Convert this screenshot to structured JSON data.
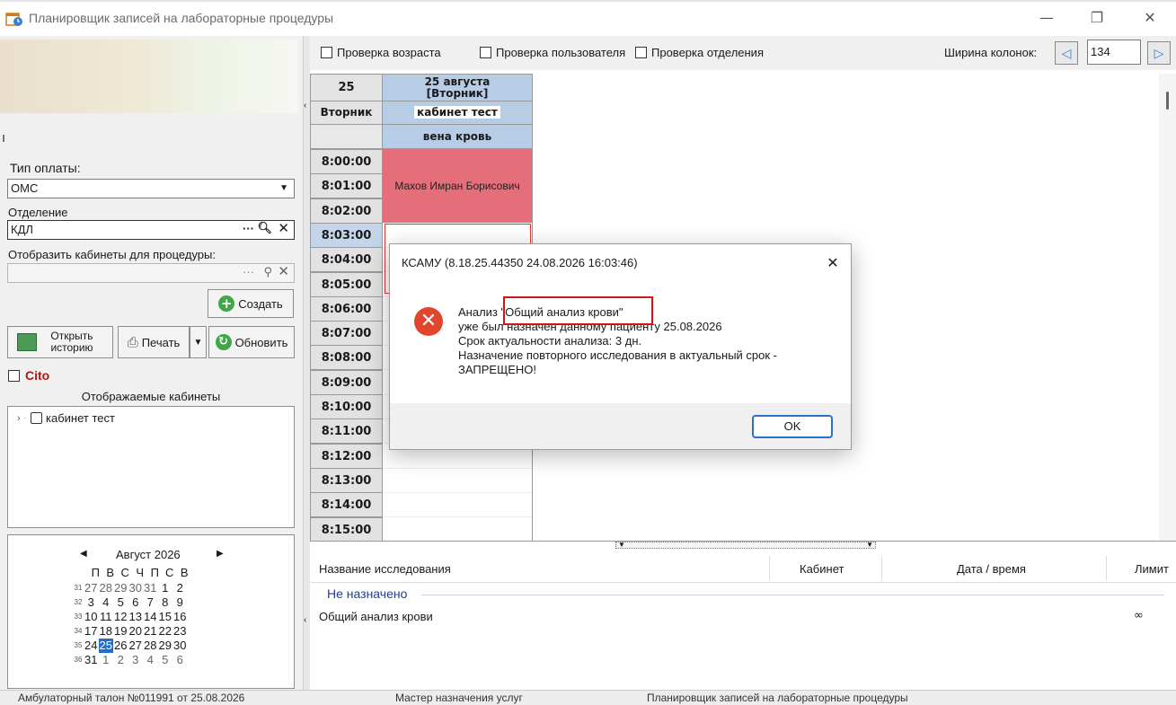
{
  "window": {
    "title": "Планировщик записей на лабораторные процедуры",
    "minimize": "—",
    "maximize": "❐",
    "close": "✕"
  },
  "left": {
    "payment_label": "Тип оплаты:",
    "payment_value": "ОМС",
    "department_label": "Отделение",
    "department_value": "КДЛ",
    "rooms_label": "Отобразить кабинеты для процедуры:",
    "create_label": "Создать",
    "open_history_label": "Открыть историю",
    "print_label": "Печать",
    "refresh_label": "Обновить",
    "cito_label": "Cito",
    "shown_rooms_label": "Отображаемые кабинеты",
    "tree_items": [
      {
        "label": "кабинет тест"
      }
    ]
  },
  "calendar": {
    "month_label": "Август 2026",
    "weekday_headers": [
      "П",
      "В",
      "С",
      "Ч",
      "П",
      "С",
      "В"
    ],
    "weeks": [
      {
        "num": "31",
        "days": [
          "27",
          "28",
          "29",
          "30",
          "31",
          "1",
          "2"
        ]
      },
      {
        "num": "32",
        "days": [
          "3",
          "4",
          "5",
          "6",
          "7",
          "8",
          "9"
        ]
      },
      {
        "num": "33",
        "days": [
          "10",
          "11",
          "12",
          "13",
          "14",
          "15",
          "16"
        ]
      },
      {
        "num": "34",
        "days": [
          "17",
          "18",
          "19",
          "20",
          "21",
          "22",
          "23"
        ]
      },
      {
        "num": "35",
        "days": [
          "24",
          "25",
          "26",
          "27",
          "28",
          "29",
          "30"
        ]
      },
      {
        "num": "36",
        "days": [
          "31",
          "1",
          "2",
          "3",
          "4",
          "5",
          "6"
        ]
      }
    ],
    "selected_day": "25"
  },
  "toolbar": {
    "age_check": "Проверка возраста",
    "user_check": "Проверка пользователя",
    "dept_check": "Проверка отделения",
    "col_width_label": "Ширина колонок:",
    "col_width_value": "134"
  },
  "schedule": {
    "day_number": "25",
    "day_name": "Вторник",
    "date_header_line1": "25 августа",
    "date_header_line2": "[Вторник]",
    "room": "кабинет тест",
    "procedure": "вена кровь",
    "times": [
      "8:00:00",
      "8:01:00",
      "8:02:00",
      "8:03:00",
      "8:04:00",
      "8:05:00",
      "8:06:00",
      "8:07:00",
      "8:08:00",
      "8:09:00",
      "8:10:00",
      "8:11:00",
      "8:12:00",
      "8:13:00",
      "8:14:00",
      "8:15:00"
    ],
    "booked_patient": "Махов Имран Борисович"
  },
  "bottom_table": {
    "col_name": "Название исследования",
    "col_room": "Кабинет",
    "col_datetime": "Дата / время",
    "col_limit": "Лимит",
    "group_label": "Не назначено",
    "rows": [
      {
        "name": "Общий анализ крови",
        "limit": "∞"
      }
    ]
  },
  "dialog": {
    "title": "КСАМУ (8.18.25.44350 24.08.2026 16:03:46)",
    "line1_prefix": "Анализ",
    "line1_quoted": "\"Общий анализ крови\"",
    "line2": "уже был назначен данному пациенту 25.08.2026",
    "line3": "Срок актуальности анализа: 3 дн.",
    "line4": "Назначение повторного исследования в актуальный срок -",
    "line5": "ЗАПРЕЩЕНО!",
    "ok_label": "OK"
  },
  "taskbar": {
    "items": [
      "Амбулаторный талон №011991 от 25.08.2026",
      "Мастер назначения услуг",
      "Планировщик записей на лабораторные процедуры"
    ]
  },
  "colors": {
    "booked": "#e46e7a",
    "header_blue": "#b7cde6",
    "error_red": "#e1462c",
    "selected_day": "#1f6fd1",
    "cito_red": "#b01818"
  }
}
